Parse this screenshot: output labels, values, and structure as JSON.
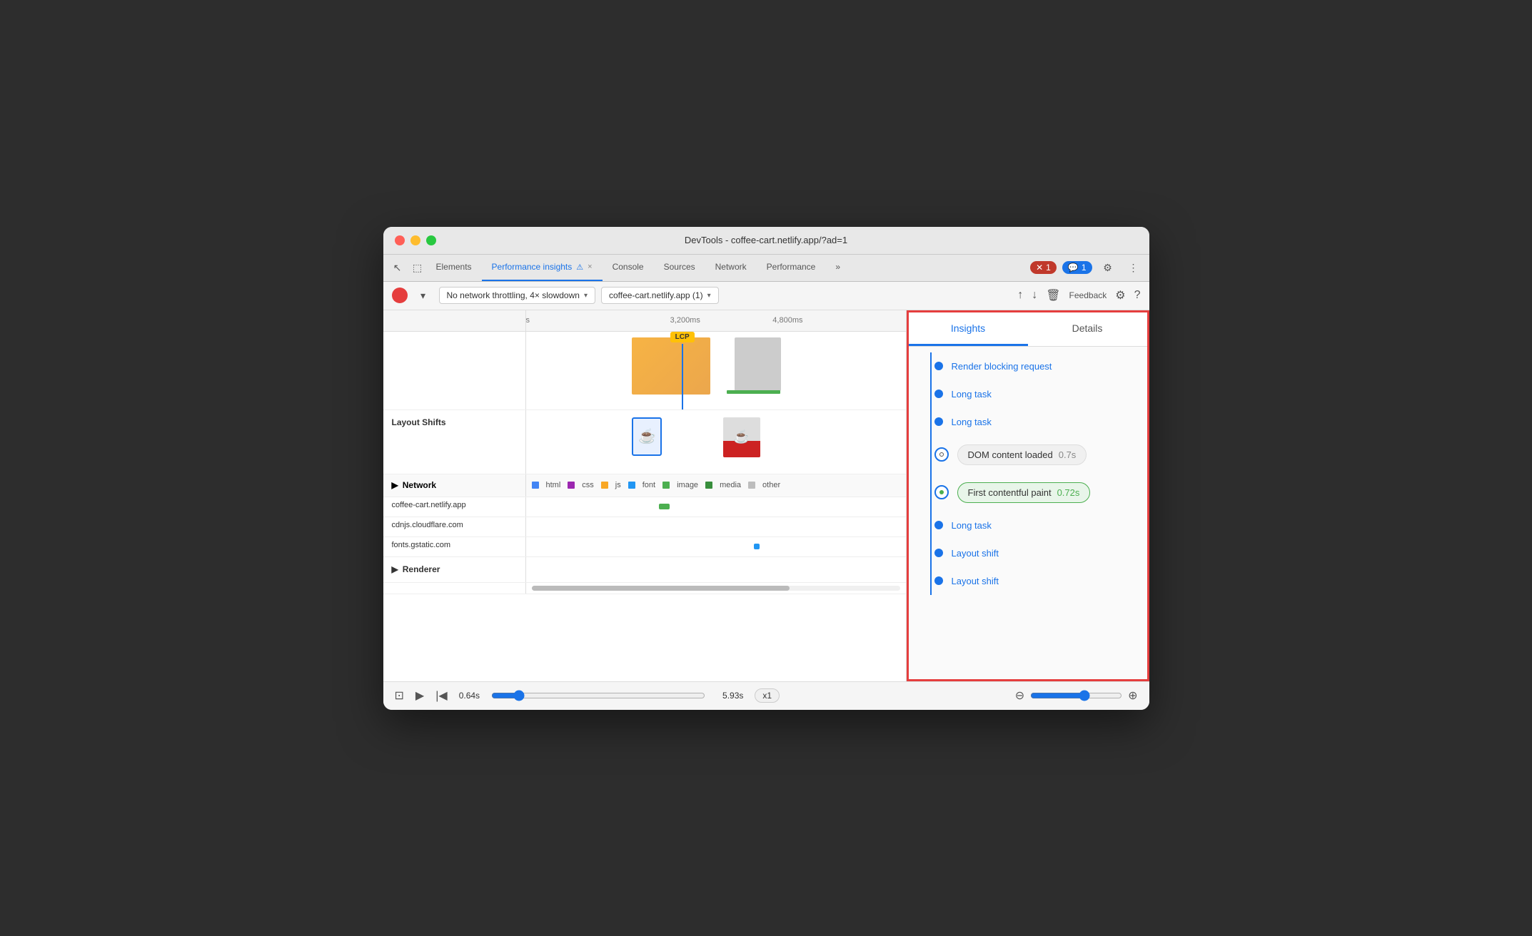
{
  "window": {
    "title": "DevTools - coffee-cart.netlify.app/?ad=1"
  },
  "tabs": {
    "items": [
      {
        "label": "Elements",
        "active": false
      },
      {
        "label": "Performance insights",
        "active": true,
        "warning": "⚠",
        "closable": true
      },
      {
        "label": "Console",
        "active": false
      },
      {
        "label": "Sources",
        "active": false
      },
      {
        "label": "Network",
        "active": false
      },
      {
        "label": "Performance",
        "active": false
      }
    ],
    "overflow": "»",
    "error_badge": "✕ 1",
    "chat_badge": "💬 1"
  },
  "toolbar": {
    "throttle_label": "No network throttling, 4× slowdown",
    "site_label": "coffee-cart.netlify.app (1)",
    "feedback_label": "Feedback"
  },
  "timeline": {
    "ruler": {
      "mark1": "s",
      "mark2": "3,200ms",
      "mark3": "4,800ms"
    },
    "lcp_label": "LCP",
    "sections": [
      {
        "label": "Layout Shifts"
      },
      {
        "label": "Network"
      },
      {
        "label": "Renderer"
      }
    ],
    "network_legend": [
      {
        "color": "#4285f4",
        "label": "html"
      },
      {
        "color": "#9c27b0",
        "label": "css"
      },
      {
        "color": "#f9a825",
        "label": "js"
      },
      {
        "color": "#2196f3",
        "label": "font"
      },
      {
        "color": "#4caf50",
        "label": "image"
      },
      {
        "color": "#388e3c",
        "label": "media"
      },
      {
        "color": "#bdbdbd",
        "label": "other"
      }
    ],
    "network_rows": [
      {
        "label": "coffee-cart.netlify.app"
      },
      {
        "label": "cdnjs.cloudflare.com"
      },
      {
        "label": "fonts.gstatic.com"
      }
    ]
  },
  "insights": {
    "tab_insights": "Insights",
    "tab_details": "Details",
    "items": [
      {
        "type": "link",
        "label": "Render blocking request"
      },
      {
        "type": "link",
        "label": "Long task"
      },
      {
        "type": "link",
        "label": "Long task"
      },
      {
        "type": "dom_loaded",
        "label": "DOM content loaded",
        "value": "0.7s"
      },
      {
        "type": "fcp",
        "label": "First contentful paint",
        "value": "0.72s"
      },
      {
        "type": "link",
        "label": "Long task"
      },
      {
        "type": "link",
        "label": "Layout shift"
      },
      {
        "type": "link",
        "label": "Layout shift"
      }
    ]
  },
  "bottom_bar": {
    "time_current": "0.64s",
    "time_end": "5.93s",
    "speed": "x1",
    "zoom_minus": "−",
    "zoom_plus": "+"
  }
}
